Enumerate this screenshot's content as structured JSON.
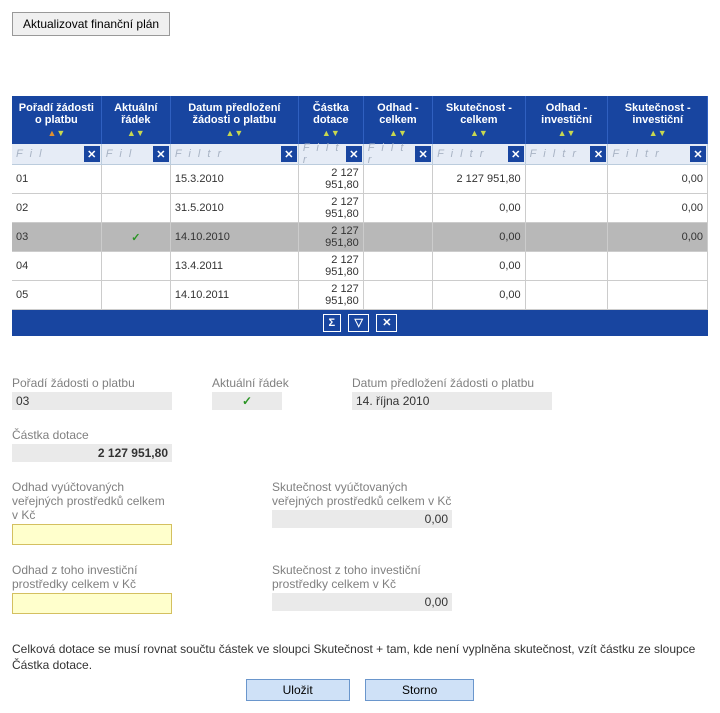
{
  "top_button": "Aktualizovat finanční plán",
  "columns": [
    {
      "key": "poradi",
      "label": "Pořadí žádosti o platbu",
      "filter": "F i l"
    },
    {
      "key": "radek",
      "label": "Aktuální řádek",
      "filter": "F i l"
    },
    {
      "key": "datum",
      "label": "Datum předložení žádosti o platbu",
      "filter": "F i l t r"
    },
    {
      "key": "castka",
      "label": "Částka dotace",
      "filter": "F i l t r"
    },
    {
      "key": "odhad_celkem",
      "label": "Odhad - celkem",
      "filter": "F i l t r"
    },
    {
      "key": "skut_celkem",
      "label": "Skutečnost - celkem",
      "filter": "F i l t r"
    },
    {
      "key": "odhad_inv",
      "label": "Odhad - investiční",
      "filter": "F i l t r"
    },
    {
      "key": "skut_inv",
      "label": "Skutečnost - investiční",
      "filter": "F i l t r"
    }
  ],
  "rows": [
    {
      "poradi": "01",
      "radek": "",
      "datum": "15.3.2010",
      "castka": "2 127 951,80",
      "odhad_celkem": "",
      "skut_celkem": "2 127 951,80",
      "odhad_inv": "",
      "skut_inv": "0,00",
      "sel": false
    },
    {
      "poradi": "02",
      "radek": "",
      "datum": "31.5.2010",
      "castka": "2 127 951,80",
      "odhad_celkem": "",
      "skut_celkem": "0,00",
      "odhad_inv": "",
      "skut_inv": "0,00",
      "sel": false
    },
    {
      "poradi": "03",
      "radek": "✓",
      "datum": "14.10.2010",
      "castka": "2 127 951,80",
      "odhad_celkem": "",
      "skut_celkem": "0,00",
      "odhad_inv": "",
      "skut_inv": "0,00",
      "sel": true
    },
    {
      "poradi": "04",
      "radek": "",
      "datum": "13.4.2011",
      "castka": "2 127 951,80",
      "odhad_celkem": "",
      "skut_celkem": "0,00",
      "odhad_inv": "",
      "skut_inv": "",
      "sel": false
    },
    {
      "poradi": "05",
      "radek": "",
      "datum": "14.10.2011",
      "castka": "2 127 951,80",
      "odhad_celkem": "",
      "skut_celkem": "0,00",
      "odhad_inv": "",
      "skut_inv": "",
      "sel": false
    }
  ],
  "footer_icons": {
    "sum": "Σ",
    "funnel": "▽",
    "clear": "✕"
  },
  "detail": {
    "poradi": {
      "label": "Pořadí žádosti o platbu",
      "value": "03"
    },
    "radek": {
      "label": "Aktuální řádek",
      "value": "✓"
    },
    "datum": {
      "label": "Datum předložení žádosti o platbu",
      "value": "14. října 2010"
    },
    "castka": {
      "label": "Částka dotace",
      "value": "2 127 951,80"
    },
    "odhad_ver": {
      "label": "Odhad vyúčtovaných veřejných prostředků celkem v Kč",
      "value": ""
    },
    "skut_ver": {
      "label": "Skutečnost vyúčtovaných veřejných prostředků celkem v Kč",
      "value": "0,00"
    },
    "odhad_inv2": {
      "label": "Odhad z toho investiční prostředky celkem v Kč",
      "value": ""
    },
    "skut_inv2": {
      "label": "Skutečnost z toho investiční prostředky celkem v Kč",
      "value": "0,00"
    }
  },
  "note_text": "Celková dotace se musí rovnat součtu částek ve sloupci Skutečnost + tam, kde není vyplněna skutečnost, vzít částku ze sloupce Částka dotace.",
  "save_label": "Uložit",
  "cancel_label": "Storno"
}
